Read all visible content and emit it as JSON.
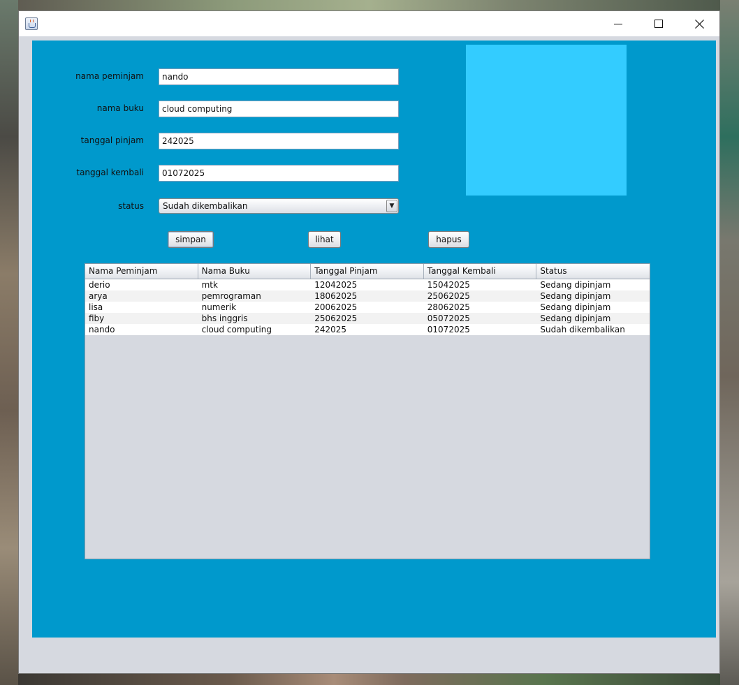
{
  "window": {
    "title": "",
    "icon": "java-coffee-cup-icon",
    "controls": [
      "minimize-icon",
      "maximize-icon",
      "close-icon"
    ]
  },
  "form": {
    "nama_peminjam": {
      "label": "nama peminjam",
      "value": "nando"
    },
    "nama_buku": {
      "label": "nama buku",
      "value": "cloud computing"
    },
    "tanggal_pinjam": {
      "label": "tanggal pinjam",
      "value": "242025"
    },
    "tanggal_kembali": {
      "label": "tanggal kembali",
      "value": "01072025"
    },
    "status": {
      "label": "status",
      "value": "Sudah dikembalikan",
      "arrow": "▼"
    }
  },
  "buttons": {
    "simpan": "simpan",
    "lihat": "lihat",
    "hapus": "hapus"
  },
  "table": {
    "columns": [
      "Nama Peminjam",
      "Nama Buku",
      "Tanggal Pinjam",
      "Tanggal Kembali",
      "Status"
    ],
    "rows": [
      [
        "derio",
        "mtk",
        "12042025",
        "15042025",
        "Sedang dipinjam"
      ],
      [
        "arya",
        "pemrograman",
        "18062025",
        "25062025",
        "Sedang dipinjam"
      ],
      [
        "lisa",
        "numerik",
        "20062025",
        "28062025",
        "Sedang dipinjam"
      ],
      [
        "fiby",
        "bhs inggris",
        "25062025",
        "05072025",
        "Sedang dipinjam"
      ],
      [
        "nando",
        "cloud computing",
        "242025",
        "01072025",
        "Sudah dikembalikan"
      ]
    ]
  },
  "colors": {
    "panel_background": "#0099cc",
    "picture_box": "#33ccff",
    "window_background": "#d6d9e0"
  }
}
